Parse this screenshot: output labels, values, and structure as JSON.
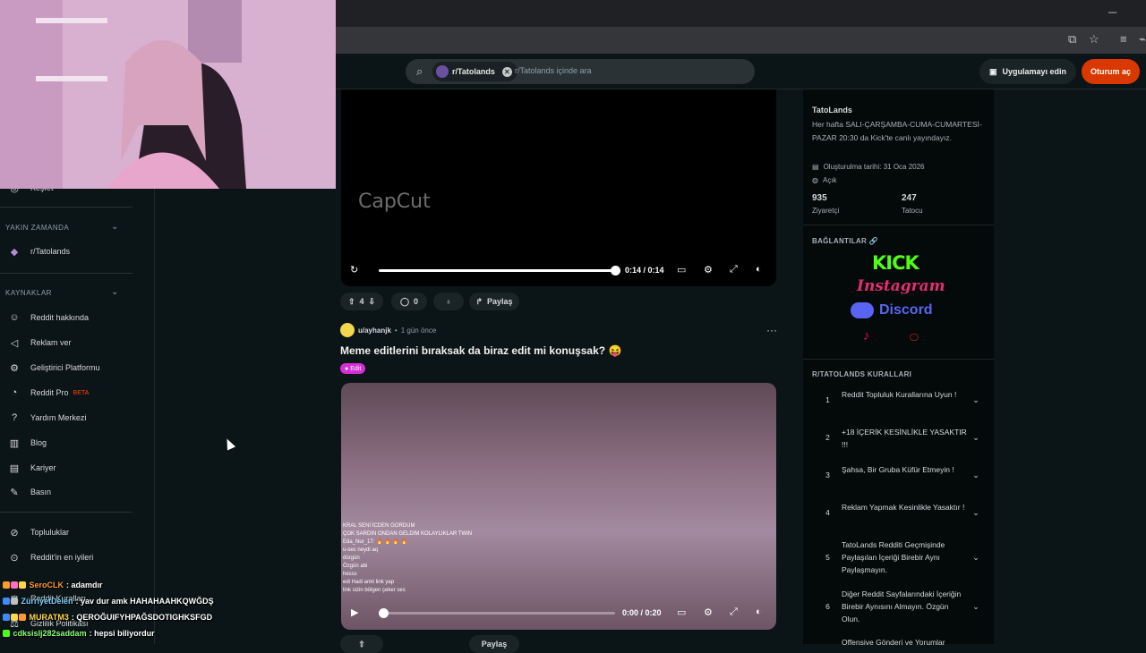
{
  "browser": {
    "controls": [
      "─",
      "☐",
      "✕"
    ],
    "bar_icons": [
      "⧉",
      "☆",
      "≡",
      "⌁"
    ]
  },
  "header": {
    "search_chip": "r/Tatolands",
    "search_placeholder": "r/Tatolands içinde ara",
    "get_app": "Uygulamayı edin",
    "login": "Oturum aç"
  },
  "left_sidebar": {
    "partial_item": "Keşfet",
    "recent_head": "YAKIN ZAMANDA",
    "recent_items": [
      {
        "label": "r/Tatolands"
      }
    ],
    "resources_head": "KAYNAKLAR",
    "resources": [
      {
        "label": "Reddit hakkında",
        "icon": "reddit-icon"
      },
      {
        "label": "Reklam ver",
        "icon": "megaphone-icon"
      },
      {
        "label": "Geliştirici Platformu",
        "icon": "gear-icon"
      },
      {
        "label": "Reddit Pro",
        "icon": "pro-icon",
        "badge": "BETA"
      },
      {
        "label": "Yardım Merkezi",
        "icon": "help-icon"
      },
      {
        "label": "Blog",
        "icon": "book-icon"
      },
      {
        "label": "Kariyer",
        "icon": "briefcase-icon"
      },
      {
        "label": "Basın",
        "icon": "mic-icon"
      }
    ],
    "bottom": [
      {
        "label": "Topluluklar",
        "icon": "communities-icon"
      },
      {
        "label": "Reddit'in en iyileri",
        "icon": "best-icon"
      },
      {
        "label": "Reddit Kuralları",
        "icon": "rules-icon"
      },
      {
        "label": "Gizlilik Politikası",
        "icon": "privacy-icon"
      }
    ]
  },
  "chat_overlay": [
    {
      "user": "SeroCLK",
      "user_color": "#ff9a2e",
      "text": ": adamdır"
    },
    {
      "user": "ZürriyetDelen",
      "user_color": "#7cd1ff",
      "text": ": yav dur amk HAHAHAAHKQWĞDŞ"
    },
    {
      "user": "MURATM3",
      "user_color": "#ffd84a",
      "text": ": QEROĞUIFYHPAĞSDOTIGHKSFGD"
    },
    {
      "user": "cdksislj282saddam",
      "user_color": "#8bff7a",
      "text": ": hepsi biliyordur"
    }
  ],
  "post1": {
    "watermark": "CapCut",
    "time": "0:14 / 0:14",
    "progress": 1.0,
    "votes": "4",
    "comments": "0",
    "share": "Paylaş"
  },
  "post2": {
    "user": "u/ayhanjk",
    "time_ago": "1 gün önce",
    "title": "Meme editlerini bıraksak da biraz edit mi konuşsak? 😝",
    "flair": "Edit",
    "video_time": "0:00 / 0:20",
    "progress": 0.02,
    "stream_chat": [
      "KRAL SENİ İCDEN GORDUM",
      "ÇOK SARDIN ONDAN GELDİM KOLAYLIKLAR TWIN",
      "Eda_Nur_17: 🔥 🔥 🔥 🔥",
      "u-ses neydi aq",
      "dürgün",
      "Özgün abi",
      "hesss",
      "edi Hadi anlıt link yap",
      "link sizin bölgen çeker ses"
    ],
    "share": "Paylaş"
  },
  "community": {
    "name": "TatoLands",
    "description": "Her hafta SALI-ÇARŞAMBA-CUMA-CUMARTESİ-PAZAR 20:30 da Kick'te canlı yayındayız.",
    "created": "Oluşturulma tarihi: 31 Oca 2026",
    "visibility": "Açık",
    "visitors": "935",
    "visitors_label": "Ziyaretçi",
    "members": "247",
    "members_label": "Tatocu",
    "links_head": "BAĞLANTILAR 🔗",
    "links": {
      "kick": "KICK",
      "instagram": "Instagram",
      "discord": "Discord"
    },
    "rules_head": "R/TATOLANDS KURALLARI",
    "rules": [
      {
        "num": "1",
        "text": "Reddit Topluluk Kurallarına Uyun !"
      },
      {
        "num": "2",
        "text": "+18 İÇERİK KESİNLİKLE YASAKTIR !!!"
      },
      {
        "num": "3",
        "text": "Şahsa, Bir Gruba Küfür Etmeyin !"
      },
      {
        "num": "4",
        "text": "Reklam Yapmak Kesinlikle Yasaktır !"
      },
      {
        "num": "5",
        "text": "TatoLands Redditi Geçmişinde Paylaşılan İçeriği Birebir Aynı Paylaşmayın."
      },
      {
        "num": "6",
        "text": "Diğer Reddit Sayfalarındaki İçeriğin Birebir Aynısını Almayın. Özgün Olun."
      },
      {
        "num": "",
        "text": "Offensive Gönderi ve Yorumlar"
      }
    ]
  }
}
